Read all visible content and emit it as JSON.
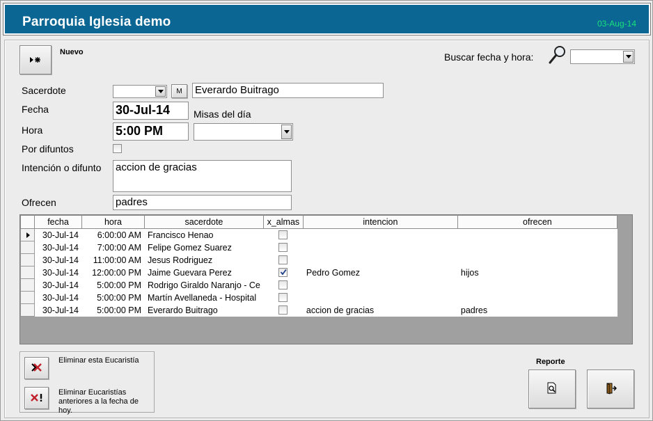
{
  "header": {
    "title": "Parroquia Iglesia demo",
    "date": "03-Aug-14"
  },
  "toolbar": {
    "new_label": "Nuevo",
    "search_label": "Buscar fecha y hora:",
    "search_value": ""
  },
  "form": {
    "sacerdote_label": "Sacerdote",
    "sacerdote_combo_value": "",
    "m_button_label": "M",
    "sacerdote_name": "Everardo Buitrago",
    "fecha_label": "Fecha",
    "fecha_value": "30-Jul-14",
    "misas_label": "Misas del día",
    "hora_label": "Hora",
    "hora_value": "5:00 PM",
    "misas_value": "",
    "difuntos_label": "Por difuntos",
    "difuntos_checked": false,
    "intencion_label": "Intención o difunto",
    "intencion_value": "accion de gracias",
    "ofrecen_label": "Ofrecen",
    "ofrecen_value": "padres"
  },
  "grid": {
    "columns": [
      "fecha",
      "hora",
      "sacerdote",
      "x_almas",
      "intencion",
      "ofrecen"
    ],
    "rows": [
      {
        "fecha": "30-Jul-14",
        "hora": "6:00:00 AM",
        "sacerdote": "Francisco Henao",
        "x_almas": false,
        "intencion": "",
        "ofrecen": "",
        "current": true
      },
      {
        "fecha": "30-Jul-14",
        "hora": "7:00:00 AM",
        "sacerdote": "Felipe Gomez Suarez",
        "x_almas": false,
        "intencion": "",
        "ofrecen": ""
      },
      {
        "fecha": "30-Jul-14",
        "hora": "11:00:00 AM",
        "sacerdote": "Jesus Rodriguez",
        "x_almas": false,
        "intencion": "",
        "ofrecen": ""
      },
      {
        "fecha": "30-Jul-14",
        "hora": "12:00:00 PM",
        "sacerdote": "Jaime Guevara Perez",
        "x_almas": true,
        "intencion": "Pedro Gomez",
        "ofrecen": "hijos"
      },
      {
        "fecha": "30-Jul-14",
        "hora": "5:00:00 PM",
        "sacerdote": "Rodrigo Giraldo Naranjo - Ce",
        "x_almas": false,
        "intencion": "",
        "ofrecen": ""
      },
      {
        "fecha": "30-Jul-14",
        "hora": "5:00:00 PM",
        "sacerdote": "Martín Avellaneda - Hospital",
        "x_almas": false,
        "intencion": "",
        "ofrecen": ""
      },
      {
        "fecha": "30-Jul-14",
        "hora": "5:00:00 PM",
        "sacerdote": "Everardo Buitrago",
        "x_almas": false,
        "intencion": "accion de gracias",
        "ofrecen": "padres"
      }
    ]
  },
  "actions": {
    "delete_one_label": "Eliminar esta Eucaristía",
    "delete_old_label_line1": "Eliminar Eucaristías",
    "delete_old_label_line2": "anteriores a la fecha de hoy.",
    "report_label": "Reporte"
  },
  "icons": {
    "new": "new-record-icon",
    "search": "magnifier-icon",
    "delete_one": "delete-record-icon",
    "delete_old": "delete-old-icon",
    "report": "report-preview-icon",
    "exit": "exit-door-icon"
  },
  "colors": {
    "titlebar": "#0b6693",
    "title_text": "#ffffff",
    "date_text": "#17e27a",
    "delete_icon": "#c0202a"
  }
}
